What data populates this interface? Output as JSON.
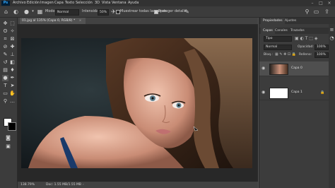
{
  "app": {
    "logo": "Ps"
  },
  "menu": [
    "Archivo",
    "Edición",
    "Imagen",
    "Capa",
    "Texto",
    "Selección",
    "3D",
    "Vista",
    "Ventana",
    "Ayuda"
  ],
  "options": {
    "modo_label": "Modo:",
    "modo_value": "Normal",
    "intensidad_label": "Intensidad:",
    "intensidad_value": "50%",
    "muestrear_label": "Muestrear todas las capas",
    "proteger_label": "Proteger detalle"
  },
  "document": {
    "tab_title": "01.jpg al 135% (Capa 0, RGB/8) *",
    "close": "×"
  },
  "status": {
    "zoom": "138.79%",
    "doc": "Doc: 1.55 MB/1.55 MB"
  },
  "panels": {
    "top_tabs": [
      "Propiedades",
      "Ajustes"
    ],
    "layer_tabs": [
      "Capas",
      "Canales",
      "Trazados"
    ],
    "filter_label": "Tipo",
    "blend_mode": "Normal",
    "opacity_label": "Opacidad:",
    "opacity_value": "100%",
    "lock_label": "Bloq.:",
    "fill_label": "Relleno:",
    "fill_value": "100%",
    "layers": [
      {
        "name": "Capa 0"
      },
      {
        "name": "Capa 1"
      }
    ]
  },
  "colors": {
    "accent": "#31a8ff",
    "ui_dark": "#323232",
    "ui_mid": "#3c3c3c",
    "canvas_bg": "#282828",
    "layer_selected": "#4f4f4f"
  }
}
